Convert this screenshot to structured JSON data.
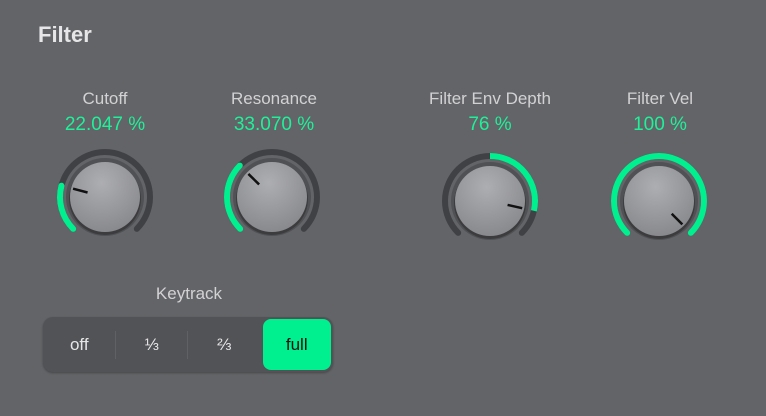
{
  "title": "Filter",
  "colors": {
    "accent": "#00ef8f",
    "track": "#404144"
  },
  "knobs": [
    {
      "id": "cutoff",
      "label": "Cutoff",
      "value_text": "22.047 %",
      "value": 0.22047,
      "bipolar": false
    },
    {
      "id": "resonance",
      "label": "Resonance",
      "value_text": "33.070 %",
      "value": 0.3307,
      "bipolar": false
    },
    {
      "id": "filter-env-depth",
      "label": "Filter Env Depth",
      "value_text": "76 %",
      "value": 0.76,
      "bipolar": true
    },
    {
      "id": "filter-vel",
      "label": "Filter Vel",
      "value_text": "100 %",
      "value": 1.0,
      "bipolar": false
    }
  ],
  "keytrack": {
    "label": "Keytrack",
    "options": [
      "off",
      "⅓",
      "⅔",
      "full"
    ],
    "selected": 3
  }
}
